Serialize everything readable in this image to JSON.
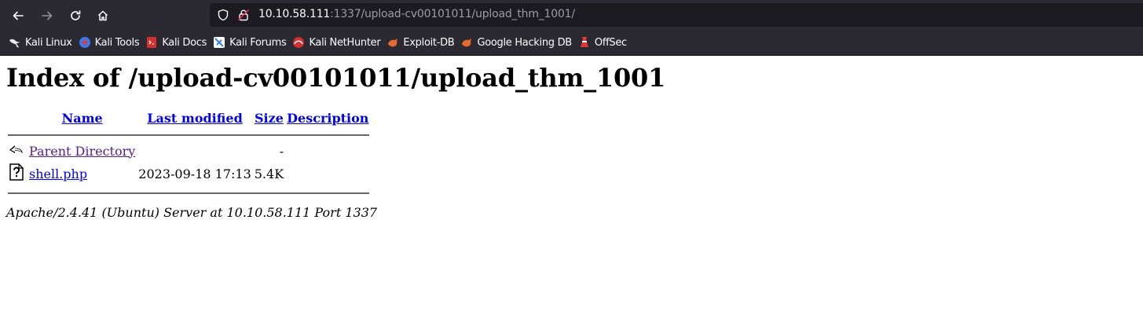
{
  "browser": {
    "url_host": "10.10.58.111",
    "url_rest": ":1337/upload-cv00101011/upload_thm_1001/",
    "nav": {
      "back_icon": "arrow-left-icon",
      "forward_icon": "arrow-right-icon",
      "reload_icon": "reload-icon",
      "home_icon": "home-icon"
    },
    "bookmarks": [
      {
        "label": "Kali Linux",
        "icon": "kali-dragon-icon"
      },
      {
        "label": "Kali Tools",
        "icon": "kali-tools-icon"
      },
      {
        "label": "Kali Docs",
        "icon": "kali-docs-icon"
      },
      {
        "label": "Kali Forums",
        "icon": "kali-forums-icon"
      },
      {
        "label": "Kali NetHunter",
        "icon": "kali-nethunter-icon"
      },
      {
        "label": "Exploit-DB",
        "icon": "exploit-db-icon"
      },
      {
        "label": "Google Hacking DB",
        "icon": "ghdb-icon"
      },
      {
        "label": "OffSec",
        "icon": "offsec-icon"
      }
    ]
  },
  "page": {
    "title": "Index of /upload-cv00101011/upload_thm_1001",
    "columns": {
      "name": "Name",
      "last_modified": "Last modified",
      "size": "Size",
      "description": "Description"
    },
    "rows": [
      {
        "icon": "back-arrow-icon",
        "name": "Parent Directory",
        "modified": "",
        "size": "-",
        "description": ""
      },
      {
        "icon": "unknown-file-icon",
        "name": "shell.php",
        "modified": "2023-09-18 17:13",
        "size": "5.4K",
        "description": ""
      }
    ],
    "footer": "Apache/2.4.41 (Ubuntu) Server at 10.10.58.111 Port 1337"
  }
}
